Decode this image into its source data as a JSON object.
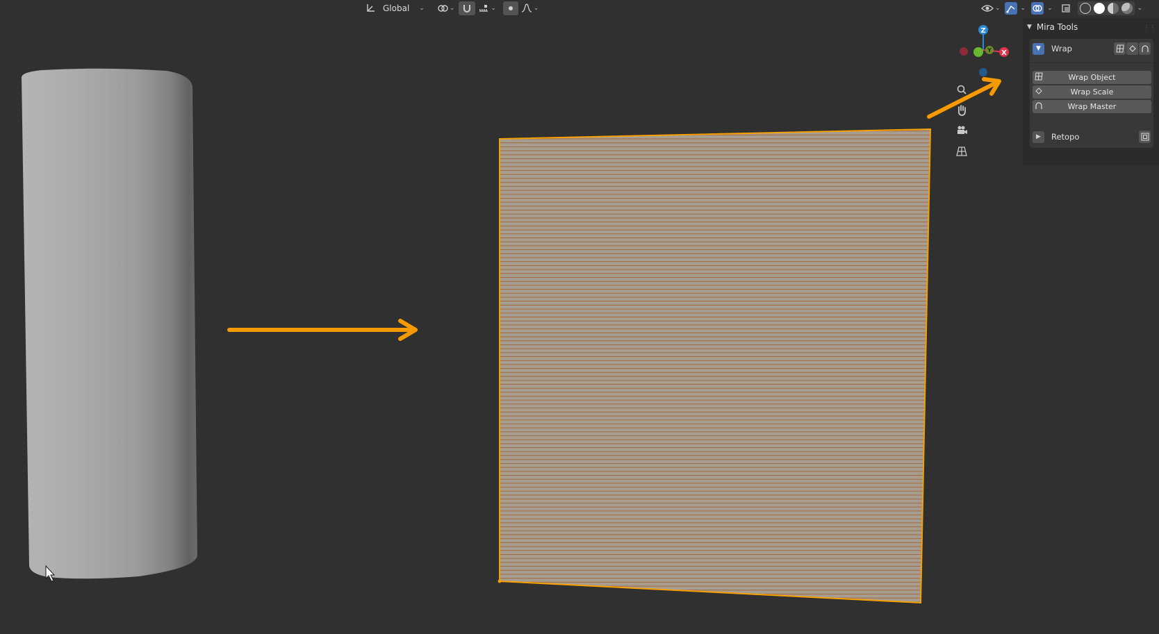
{
  "header": {
    "transform_orientation": "Global"
  },
  "gizmo": {
    "z_label": "Z",
    "y_label": "Y",
    "x_label": "X"
  },
  "mira_tools": {
    "title": "Mira Tools",
    "wrap": {
      "label": "Wrap",
      "buttons": [
        {
          "icon": "grid-icon",
          "label": "Wrap Object"
        },
        {
          "icon": "diamond-icon",
          "label": "Wrap Scale"
        },
        {
          "icon": "arch-icon",
          "label": "Wrap Master"
        }
      ]
    },
    "retopo": {
      "label": "Retopo"
    }
  },
  "colors": {
    "viewport_bg": "#303030",
    "accent_blue": "#4772b3",
    "selection_orange": "#f5a000",
    "annotation_arrow": "#f59a00"
  }
}
